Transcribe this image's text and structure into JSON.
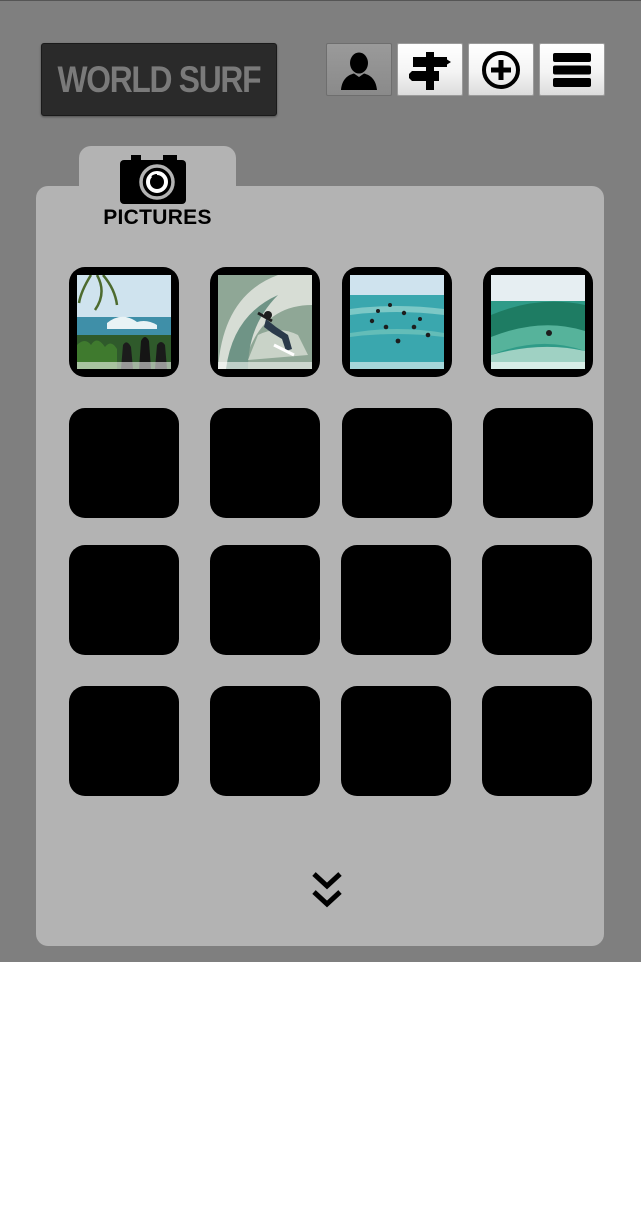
{
  "header": {
    "logo_text": "WORLD SURF",
    "toolbar": [
      {
        "name": "profile",
        "icon": "user-icon",
        "active": true
      },
      {
        "name": "directions",
        "icon": "signpost-icon",
        "active": false
      },
      {
        "name": "add",
        "icon": "plus-circle-icon",
        "active": false
      },
      {
        "name": "menu",
        "icon": "menu-icon",
        "active": false
      }
    ]
  },
  "section": {
    "icon": "camera-icon",
    "label": "PICTURES"
  },
  "gallery": {
    "photos": [
      {
        "index": 1,
        "has_image": true,
        "scene": "beach-palm"
      },
      {
        "index": 2,
        "has_image": true,
        "scene": "barrel-surfer"
      },
      {
        "index": 3,
        "has_image": true,
        "scene": "surfers-lineup"
      },
      {
        "index": 4,
        "has_image": true,
        "scene": "green-wave"
      },
      {
        "index": 5,
        "has_image": false
      },
      {
        "index": 6,
        "has_image": false
      },
      {
        "index": 7,
        "has_image": false
      },
      {
        "index": 8,
        "has_image": false
      },
      {
        "index": 9,
        "has_image": false
      },
      {
        "index": 10,
        "has_image": false
      },
      {
        "index": 11,
        "has_image": false
      },
      {
        "index": 12,
        "has_image": false
      },
      {
        "index": 13,
        "has_image": false
      },
      {
        "index": 14,
        "has_image": false
      },
      {
        "index": 15,
        "has_image": false
      },
      {
        "index": 16,
        "has_image": false
      }
    ]
  },
  "controls": {
    "more_icon": "double-chevron-down-icon"
  },
  "colors": {
    "app_background": "#7f7f7f",
    "panel": "#b3b3b3",
    "logo_bg": "#2a2a2a",
    "logo_text": "#7a7a7a",
    "thumb": "#000000"
  }
}
